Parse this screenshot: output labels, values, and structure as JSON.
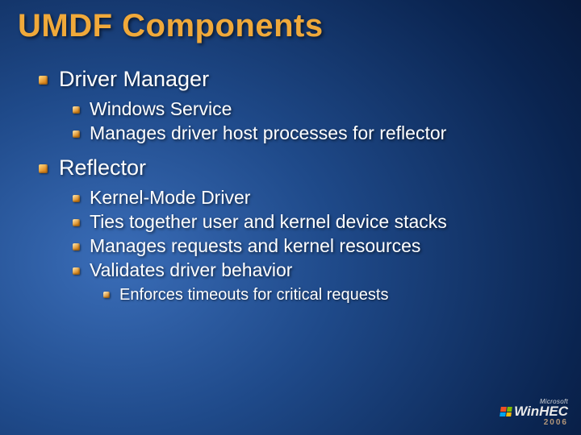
{
  "title": "UMDF Components",
  "sections": [
    {
      "heading": "Driver Manager",
      "items": [
        {
          "text": "Windows Service"
        },
        {
          "text": "Manages driver host processes for reflector"
        }
      ]
    },
    {
      "heading": "Reflector",
      "items": [
        {
          "text": "Kernel-Mode Driver"
        },
        {
          "text": "Ties together user and kernel device stacks"
        },
        {
          "text": "Manages requests and kernel resources"
        },
        {
          "text": "Validates driver behavior",
          "subitems": [
            {
              "text": "Enforces timeouts for critical requests"
            }
          ]
        }
      ]
    }
  ],
  "footer": {
    "company": "Microsoft",
    "brand": "WinHEC",
    "year": "2006"
  }
}
